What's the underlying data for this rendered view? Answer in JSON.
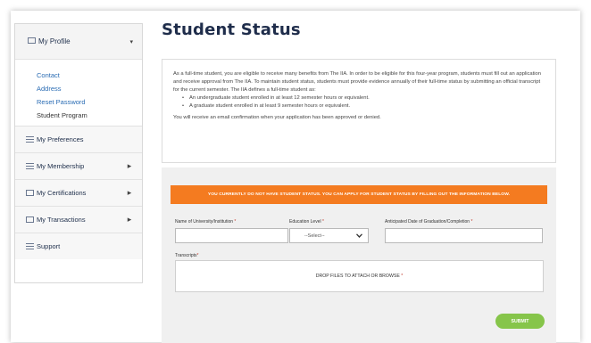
{
  "sidebar": {
    "profile": {
      "label": "My Profile",
      "caret": "▾"
    },
    "profile_items": [
      {
        "label": "Contact"
      },
      {
        "label": "Address"
      },
      {
        "label": "Reset Password"
      },
      {
        "label": "Student Program"
      }
    ],
    "sections": [
      {
        "label": "My Preferences",
        "caret": ""
      },
      {
        "label": "My Membership",
        "caret": "▸"
      },
      {
        "label": "My Certifications",
        "caret": "▸"
      },
      {
        "label": "My Transactions",
        "caret": "▸"
      },
      {
        "label": "Support",
        "caret": ""
      }
    ]
  },
  "page": {
    "title": "Student Status"
  },
  "info": {
    "para1": "As a full-time student, you are eligible to receive many benefits from The IIA. In order to be eligible for this four-year program, students must fill out an application and receive approval from The IIA. To maintain student status, students must provide evidence annually of their full-time status by submitting an official transcript for the current semester. The IIA defines a full-time student as:",
    "bullets": [
      "An undergraduate student enrolled in at least 12 semester hours or equivalent.",
      "A graduate student enrolled in at least 9 semester hours or equivalent."
    ],
    "para2": "You will receive an email confirmation when your application has been approved or denied."
  },
  "form": {
    "banner": "YOU CURRENTLY DO NOT HAVE STUDENT STATUS. YOU CAN APPLY FOR STUDENT STATUS BY FILLING OUT THE INFORMATION BELOW.",
    "university_label": "Name of University/Institution",
    "education_label": "Education Level",
    "graduation_label": "Anticipated Date of Graduation/Completion",
    "education_value": "--Select--",
    "transcripts_label": "Transcripts",
    "drop_text": "DROP FILES TO ATTACH OR BROWSE",
    "required_mark": "*",
    "submit_label": "SUBMIT"
  }
}
